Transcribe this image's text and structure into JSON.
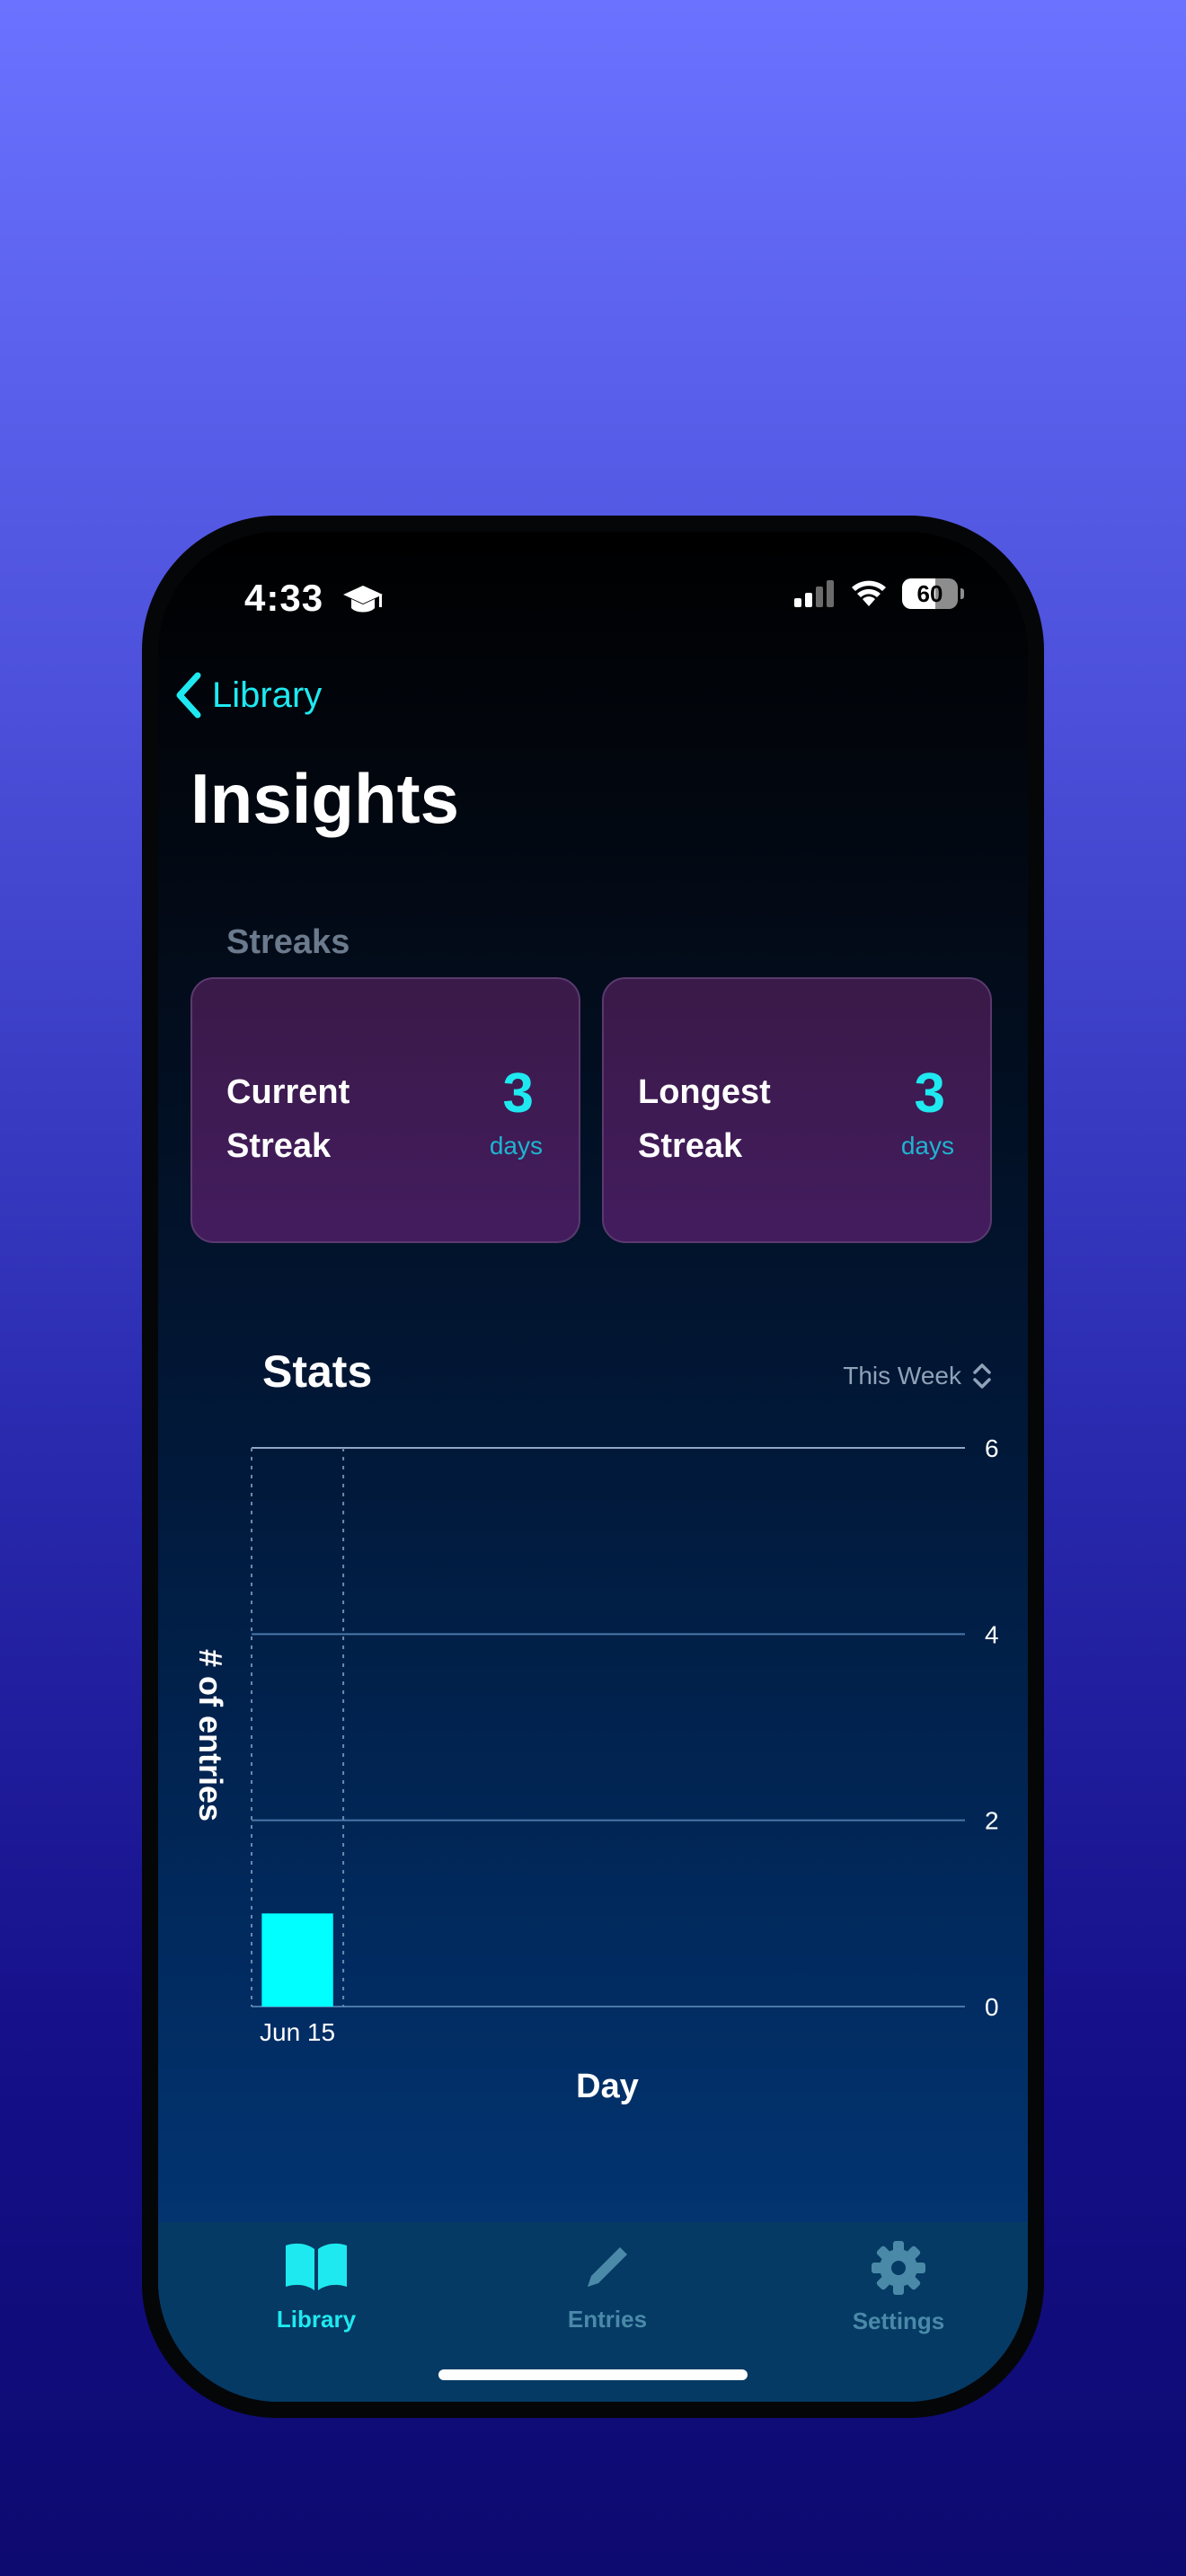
{
  "status_bar": {
    "time": "4:33",
    "battery": "60"
  },
  "nav": {
    "back_label": "Library"
  },
  "page": {
    "title": "Insights"
  },
  "streaks": {
    "section_label": "Streaks",
    "cards": [
      {
        "label_line1": "Current",
        "label_line2": "Streak",
        "value": "3",
        "unit": "days"
      },
      {
        "label_line1": "Longest",
        "label_line2": "Streak",
        "value": "3",
        "unit": "days"
      }
    ]
  },
  "stats": {
    "title": "Stats",
    "range_label": "This Week"
  },
  "chart_data": {
    "type": "bar",
    "categories": [
      "Jun 15"
    ],
    "values": [
      1
    ],
    "xlabel": "Day",
    "ylabel": "# of entries",
    "ylim": [
      0,
      6
    ],
    "yticks": [
      "0",
      "2",
      "4",
      "6"
    ],
    "grid": true,
    "bar_color": "#00ffff"
  },
  "tabbar": {
    "tabs": [
      {
        "label": "Library",
        "icon": "book-icon",
        "active": true
      },
      {
        "label": "Entries",
        "icon": "pencil-icon",
        "active": false
      },
      {
        "label": "Settings",
        "icon": "gear-icon",
        "active": false
      }
    ]
  },
  "colors": {
    "accent": "#1fe9f0",
    "card": "#3f1b57",
    "tab_inactive": "#4a8aa8"
  }
}
